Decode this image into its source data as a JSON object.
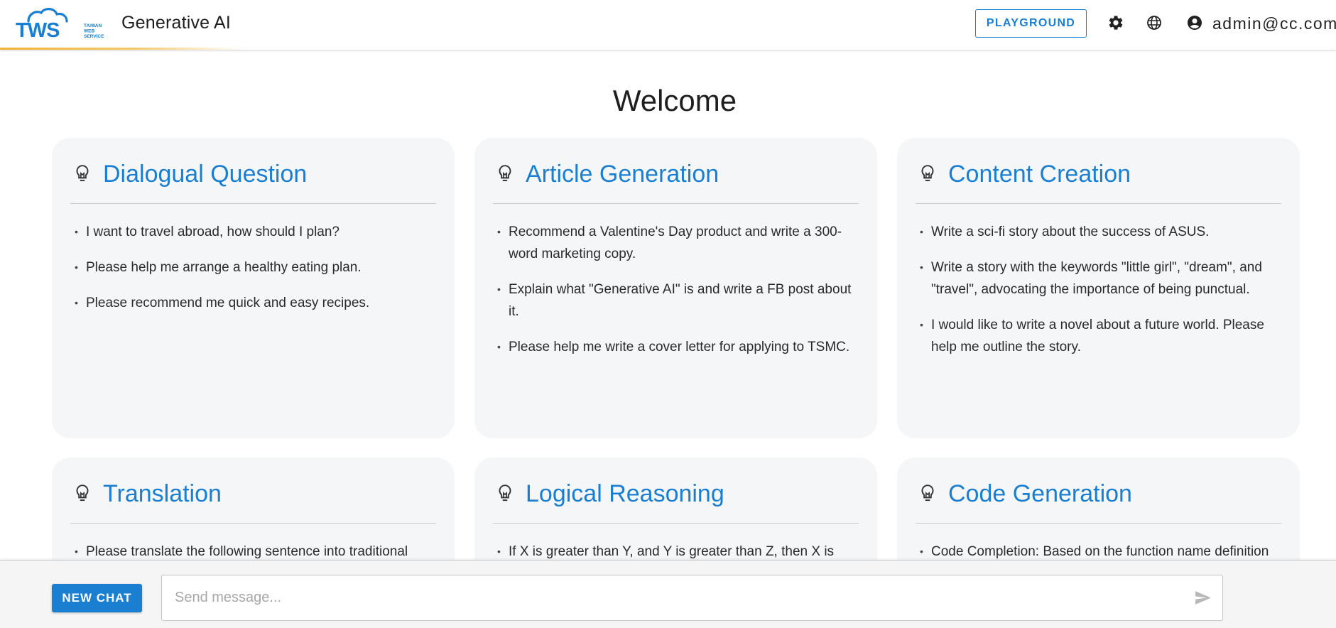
{
  "header": {
    "logo": {
      "main": "TWS",
      "sub": [
        "TAIWAN",
        "WEB",
        "SERVICE"
      ]
    },
    "title": "Generative AI",
    "playground_label": "PLAYGROUND",
    "settings_icon": "gear-icon",
    "language_icon": "globe-icon",
    "account_icon": "account-circle-icon",
    "user": "admin@cc.com"
  },
  "main": {
    "welcome": "Welcome",
    "cards": [
      {
        "title": "Dialogual Question",
        "icon": "lightbulb-icon",
        "items": [
          "I want to travel abroad, how should I plan?",
          "Please help me arrange a healthy eating plan.",
          "Please recommend me quick and easy recipes."
        ]
      },
      {
        "title": "Article Generation",
        "icon": "lightbulb-icon",
        "items": [
          "Recommend a Valentine's Day product and write a 300-word marketing copy.",
          "Explain what \"Generative AI\" is and write a FB post about it.",
          "Please help me write a cover letter for applying to TSMC."
        ]
      },
      {
        "title": "Content Creation",
        "icon": "lightbulb-icon",
        "items": [
          "Write a sci-fi story about the success of ASUS.",
          "Write a story with the keywords \"little girl\", \"dream\", and \"travel\", advocating the importance of being punctual.",
          "I would like to write a novel about a future world. Please help me outline the story."
        ]
      },
      {
        "title": "Translation",
        "icon": "lightbulb-icon",
        "items": [
          "Please translate the following sentence into traditional"
        ]
      },
      {
        "title": "Logical Reasoning",
        "icon": "lightbulb-icon",
        "items": [
          "If X is greater than Y, and Y is greater than Z, then X is"
        ]
      },
      {
        "title": "Code Generation",
        "icon": "lightbulb-icon",
        "items": [
          "Code Completion: Based on the function name definition"
        ]
      }
    ]
  },
  "footer": {
    "new_chat_label": "NEW CHAT",
    "message_placeholder": "Send message...",
    "message_value": "",
    "send_icon": "send-icon"
  },
  "colors": {
    "accent": "#1a7fd0",
    "header_stripe": "#f2b233",
    "card_bg": "#f5f6f8"
  }
}
